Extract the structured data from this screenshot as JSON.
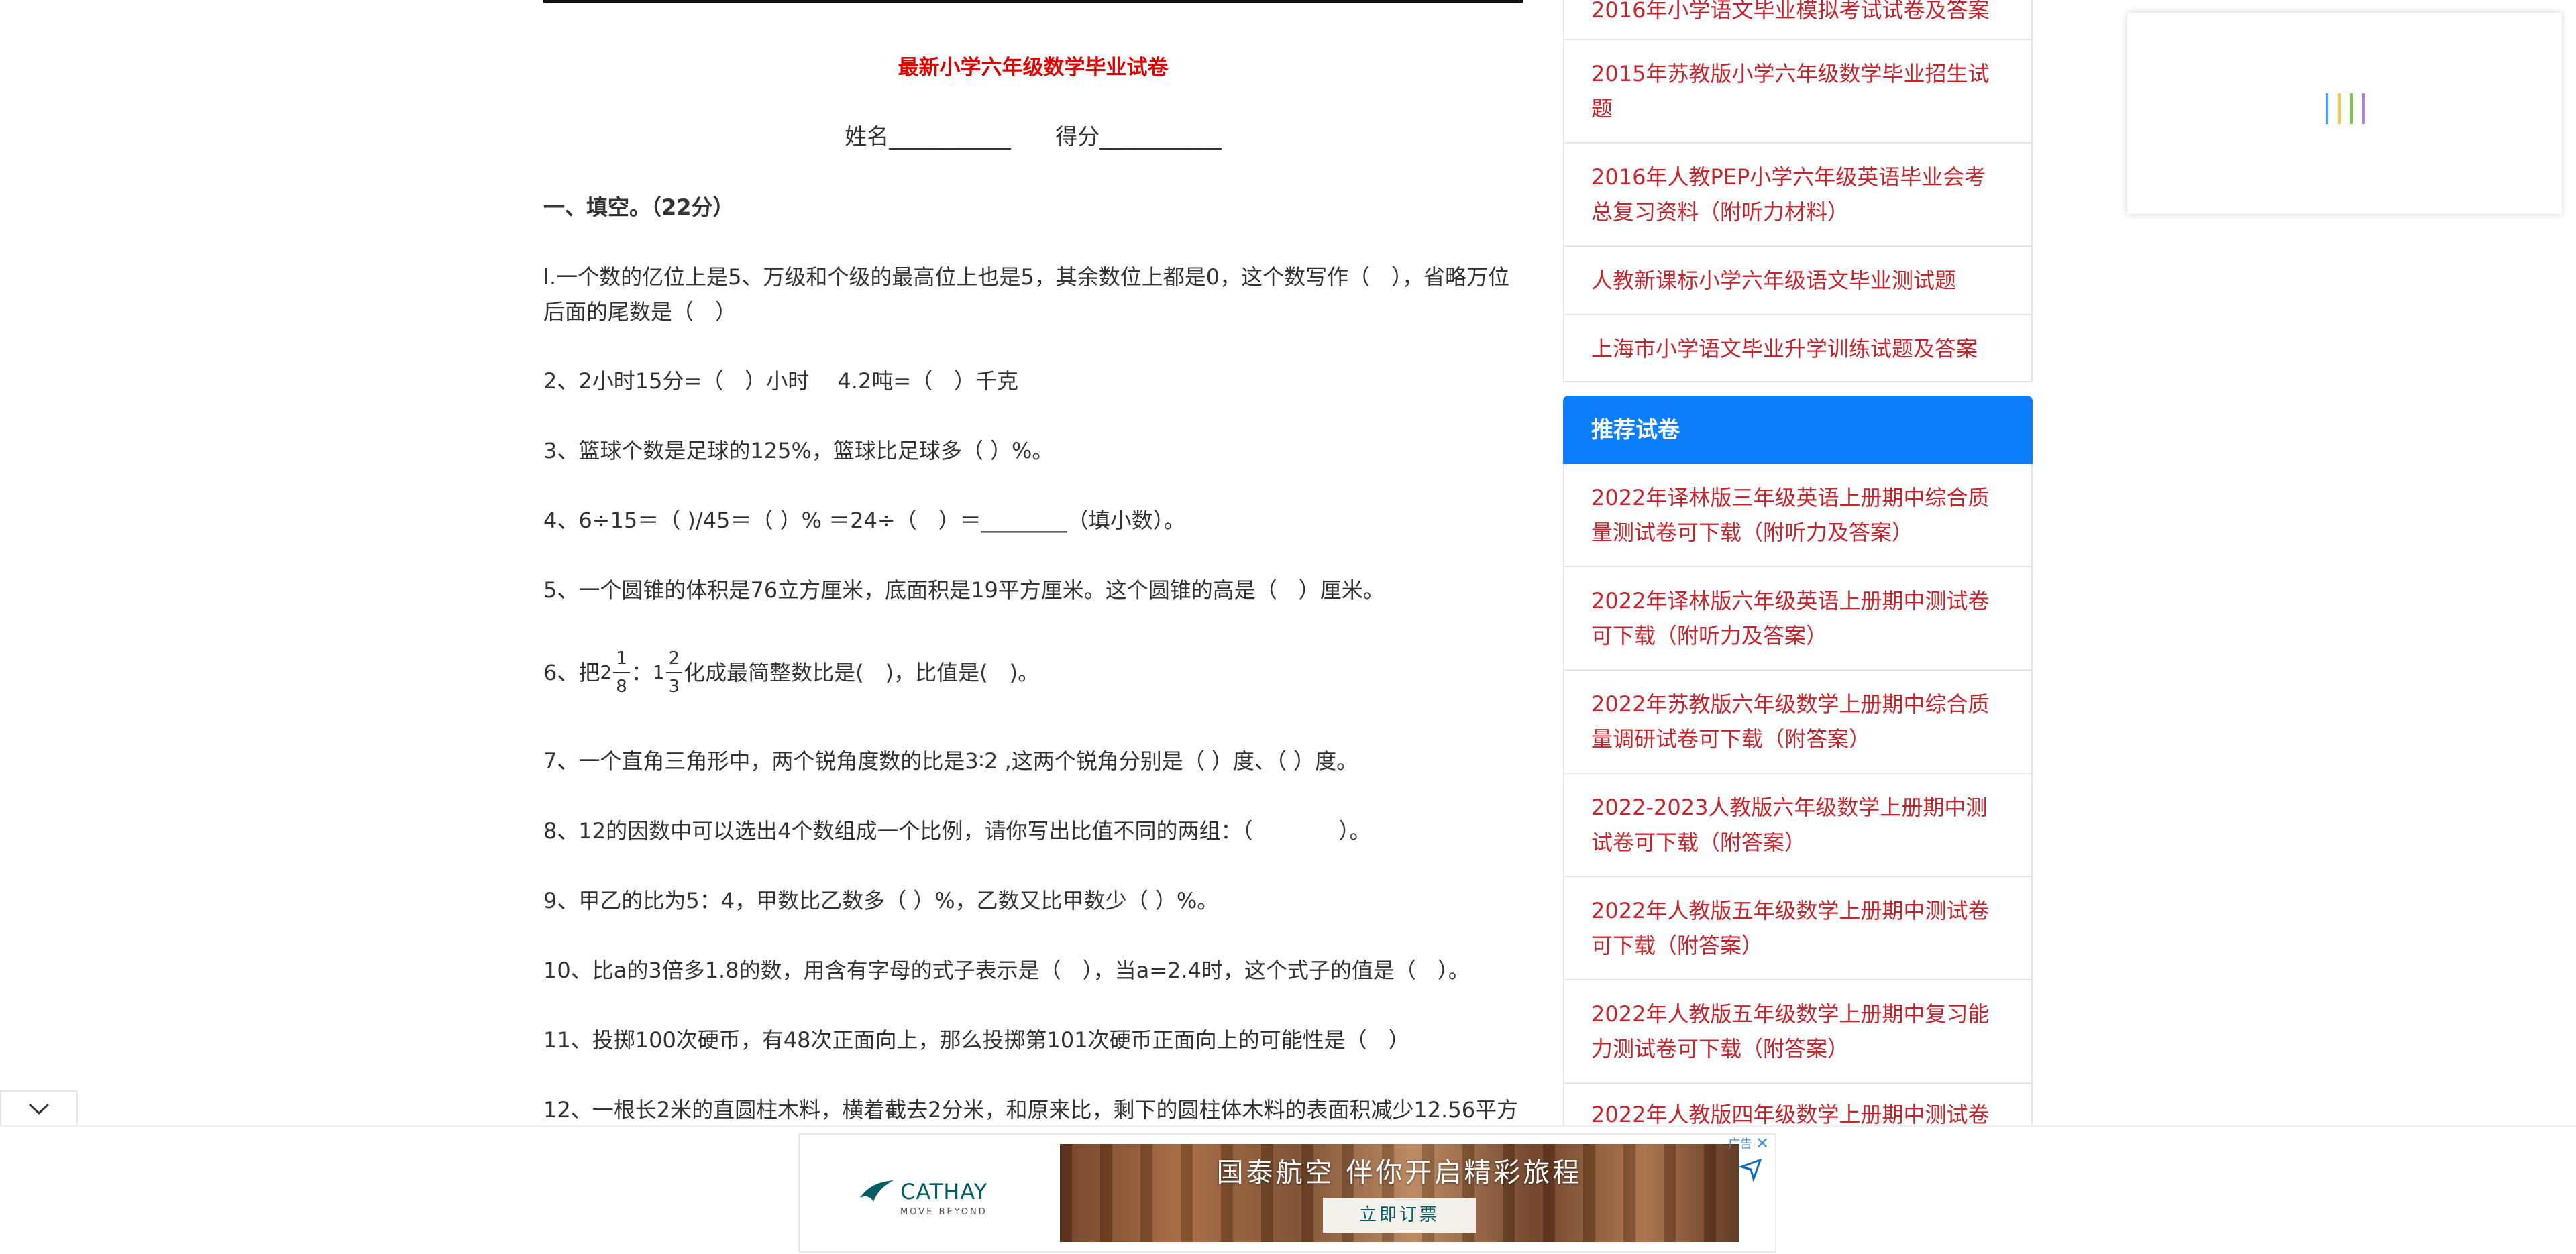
{
  "article": {
    "title": "最新小学六年级数学毕业试卷",
    "name_label": "姓名___________",
    "score_label": "得分___________",
    "section1": "一、填空。（22分）",
    "q1": "l.一个数的亿位上是5、万级和个级的最高位上也是5，其余数位上都是0，这个数写作（　），省略万位后面的尾数是（　）",
    "q2": "2、2小时15分=（　）小时　 4.2吨=（　）千克",
    "q3": "3、篮球个数是足球的125%，篮球比足球多（ ）%。",
    "q4": "4、6÷15＝（ )/45＝（ ）% ＝24÷（　）＝________（填小数）。",
    "q5": "5、一个圆锥的体积是76立方厘米，底面积是19平方厘米。这个圆锥的高是（　）厘米。",
    "q6": {
      "prefix": "6、把",
      "whole1": "2",
      "num1": "1",
      "den1": "8",
      "colon": "：",
      "whole2": "1",
      "num2": "2",
      "den2": "3",
      "suffix": "化成最简整数比是(　)，比值是(　)。"
    },
    "q7": "7、一个直角三角形中，两个锐角度数的比是3∶2 ,这两个锐角分别是（ ）度、（ ）度。",
    "q8": "8、12的因数中可以选出4个数组成一个比例，请你写出比值不同的两组：（　　　　）。",
    "q9": "9、甲乙的比为5：4，甲数比乙数多（ ）%，乙数又比甲数少（ ）%。",
    "q10": "10、比a的3倍多1.8的数，用含有字母的式子表示是（　），当a=2.4时，这个式子的值是（　）。",
    "q11": "11、投掷100次硬币，有48次正面向上，那么投掷第101次硬币正面向上的可能性是（　）",
    "q12": "12、一根长2米的直圆柱木料，横着截去2分米，和原来比，剩下的圆柱体木料的表面积减少12.56平方"
  },
  "related": [
    "2016年小学语文毕业模拟考试试卷及答案",
    "2015年苏教版小学六年级数学毕业招生试题",
    "2016年人教PEP小学六年级英语毕业会考总复习资料（附听力材料）",
    "人教新课标小学六年级语文毕业测试题",
    "上海市小学语文毕业升学训练试题及答案"
  ],
  "recommended": {
    "heading": "推荐试卷",
    "items": [
      "2022年译林版三年级英语上册期中综合质量测试卷可下载（附听力及答案）",
      "2022年译林版六年级英语上册期中测试卷可下载（附听力及答案）",
      "2022年苏教版六年级数学上册期中综合质量调研试卷可下载（附答案）",
      "2022-2023人教版六年级数学上册期中测试卷可下载（附答案）",
      "2022年人教版五年级数学上册期中测试卷可下载（附答案）",
      "2022年人教版五年级数学上册期中复习能力测试卷可下载（附答案）",
      "2022年人教版四年级数学上册期中测试卷"
    ]
  },
  "ad": {
    "label": "广告",
    "close": "✕",
    "brand": "CATHAY",
    "brand_sub": "MOVE BEYOND",
    "headline": "国泰航空 伴你开启精彩旅程",
    "cta": "立即订票"
  },
  "colors": {
    "title_red": "#e00000",
    "link_red": "#c4262e",
    "panel_blue": "#0d7efb",
    "cathay_teal": "#005d63",
    "loader_bars": [
      "#3fa9f5",
      "#f5c542",
      "#7ac943",
      "#b57ee6"
    ]
  },
  "icons": {
    "collapse": "chevron-down-icon",
    "ad_close": "close-icon",
    "ad_choice": "adchoices-arrow-icon"
  }
}
